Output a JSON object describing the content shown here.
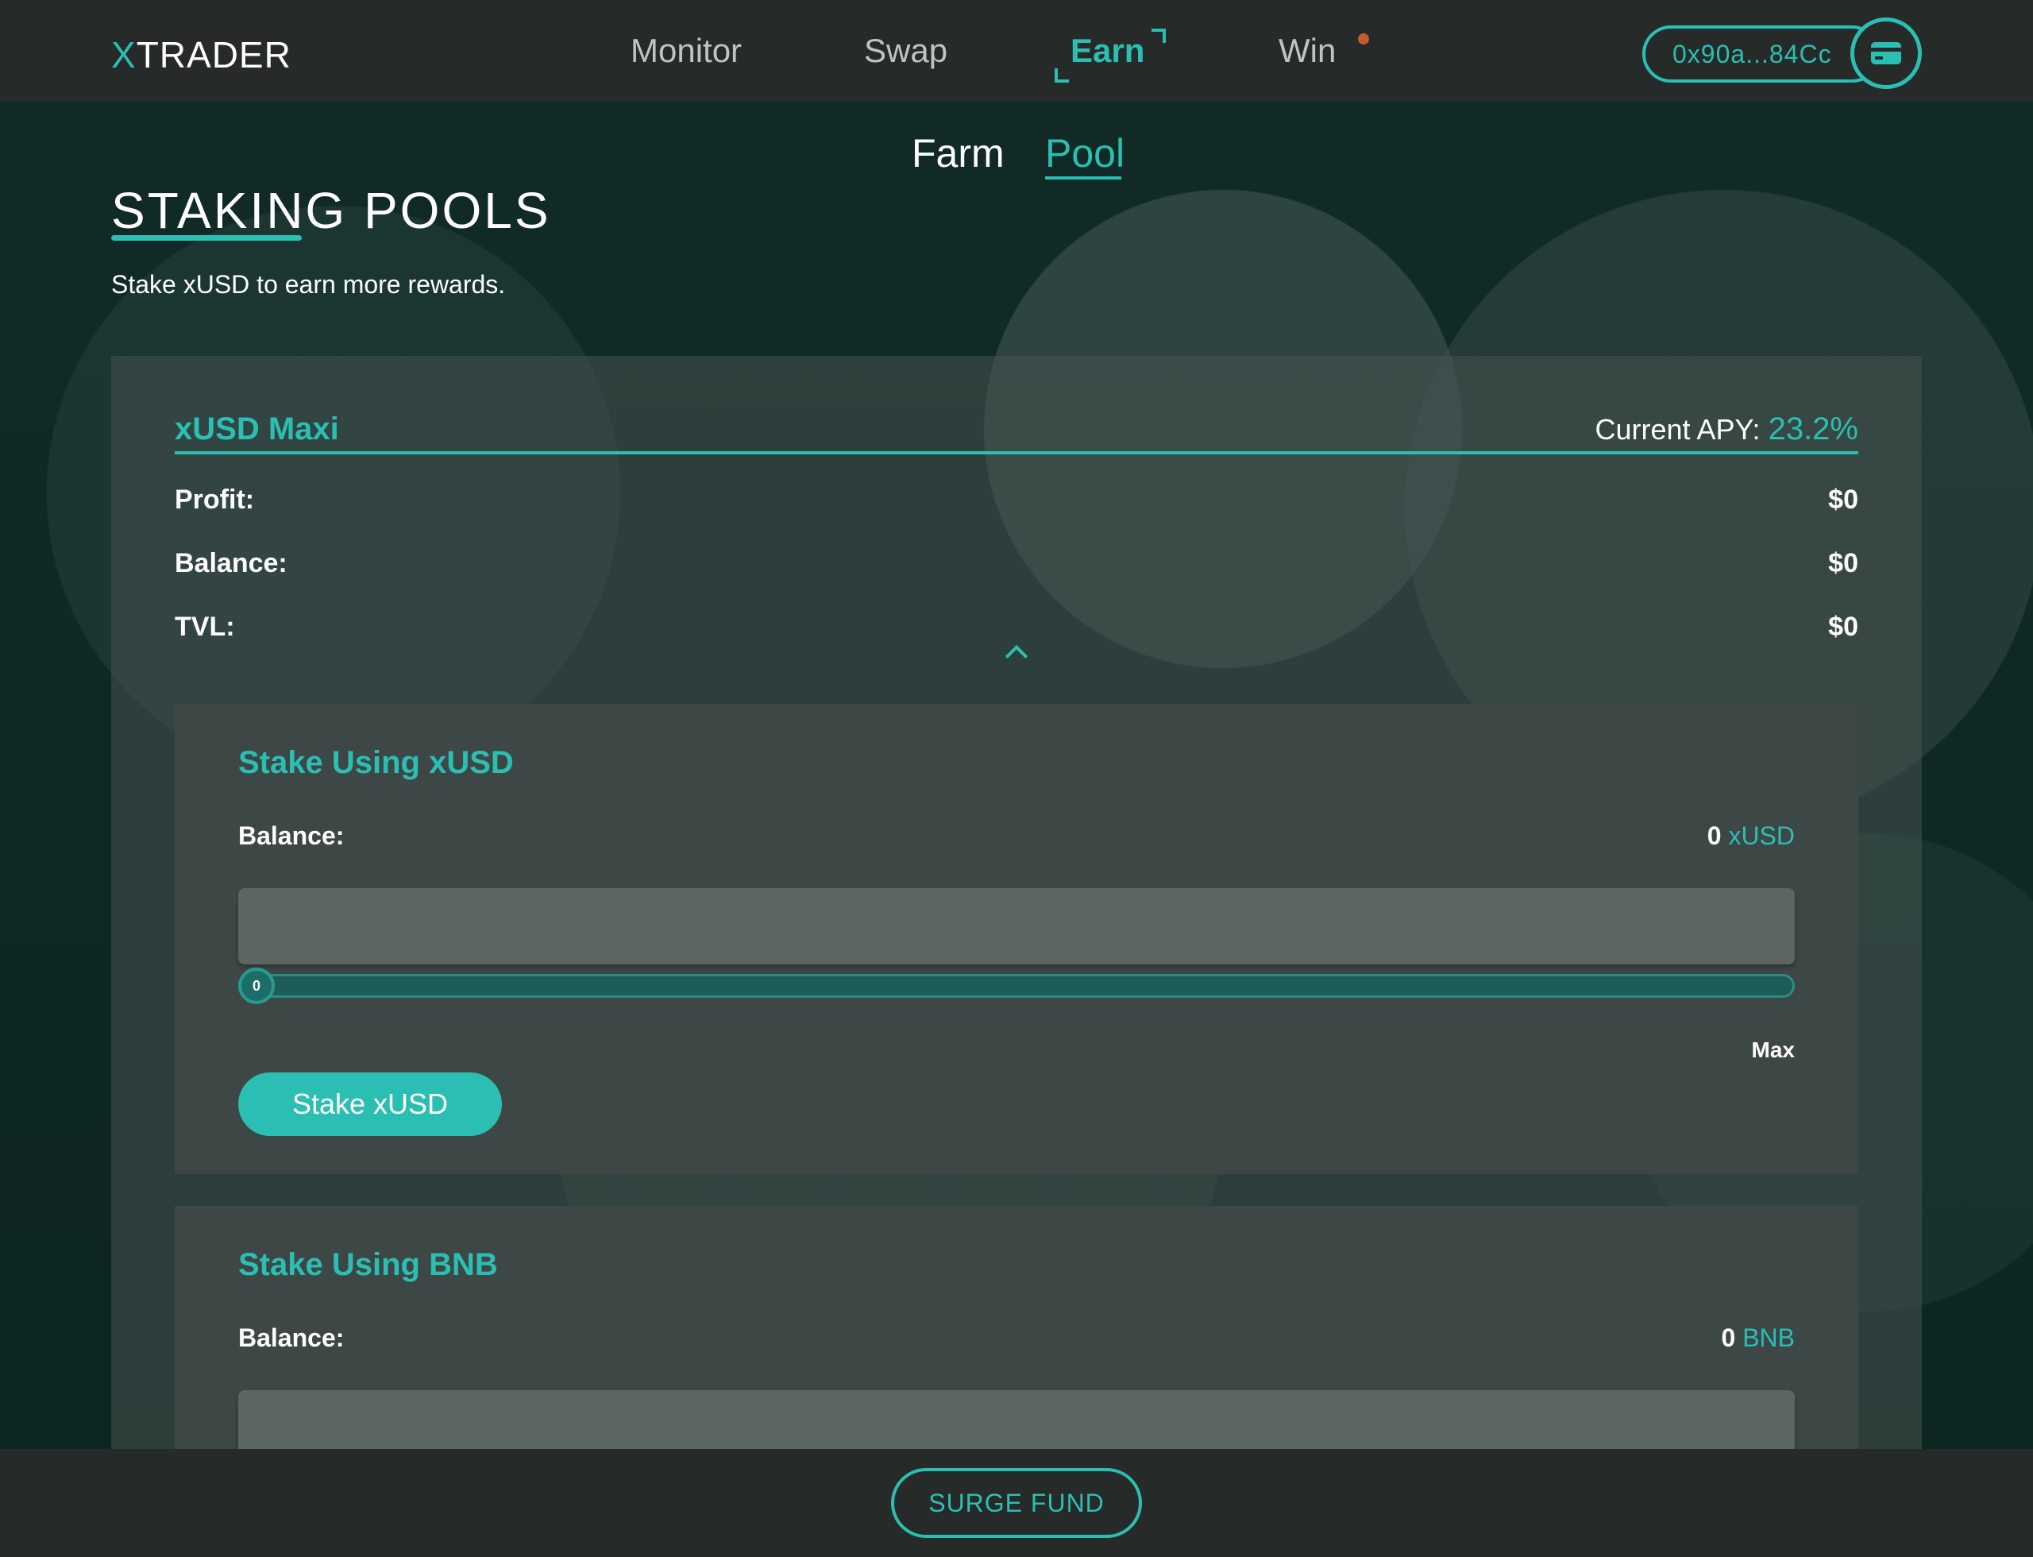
{
  "header": {
    "logo": "TRADER",
    "logo_prefix": "X",
    "nav": [
      "Monitor",
      "Swap",
      "Earn",
      "Win"
    ],
    "active_nav": "Earn",
    "wallet_address": "0x90a...84Cc",
    "wallet_icon": "wallet-icon"
  },
  "subtabs": {
    "farm": "Farm",
    "pool": "Pool",
    "active": "Pool"
  },
  "page": {
    "title": "STAKING POOLS",
    "subtitle": "Stake xUSD to earn more rewards."
  },
  "pool": {
    "name": "xUSD Maxi",
    "apy_label": "Current APY:",
    "apy_value": "23.2%",
    "stats": [
      {
        "label": "Profit:",
        "value": "$0"
      },
      {
        "label": "Balance:",
        "value": "$0"
      },
      {
        "label": "TVL:",
        "value": "$0"
      }
    ],
    "collapse_icon": "chevron-up-icon"
  },
  "stake_xusd": {
    "title": "Stake Using xUSD",
    "balance_label": "Balance:",
    "balance_amount": "0",
    "balance_token": "xUSD",
    "input_value": "",
    "slider_value": "0",
    "slider_fraction": 0,
    "max_label": "Max",
    "button": "Stake xUSD"
  },
  "stake_bnb": {
    "title": "Stake Using BNB",
    "balance_label": "Balance:",
    "balance_amount": "0",
    "balance_token": "BNB",
    "input_value": ""
  },
  "footer": {
    "button": "SURGE FUND"
  },
  "colors": {
    "accent": "#2bbfb3",
    "header_bg": "#262a29",
    "notification_dot": "#c45a2f"
  }
}
